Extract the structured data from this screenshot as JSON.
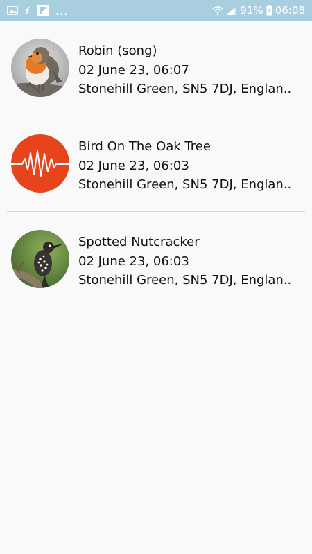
{
  "status_bar": {
    "left_icons": [
      "image-icon",
      "sync-icon",
      "flipboard-icon"
    ],
    "overflow": "...",
    "battery_percent": "91%",
    "time": "06:08"
  },
  "recordings": [
    {
      "title": "Robin (song)",
      "datetime": "02 June 23, 06:07",
      "location": "Stonehill Green, SN5 7DJ, Englan..",
      "thumb": "robin-photo"
    },
    {
      "title": "Bird On The Oak Tree",
      "datetime": "02 June 23, 06:03",
      "location": "Stonehill Green, SN5 7DJ, Englan..",
      "thumb": "waveform-icon",
      "accent": "#e8441b"
    },
    {
      "title": "Spotted Nutcracker",
      "datetime": "02 June 23, 06:03",
      "location": "Stonehill Green, SN5 7DJ, Englan..",
      "thumb": "nutcracker-photo"
    }
  ]
}
